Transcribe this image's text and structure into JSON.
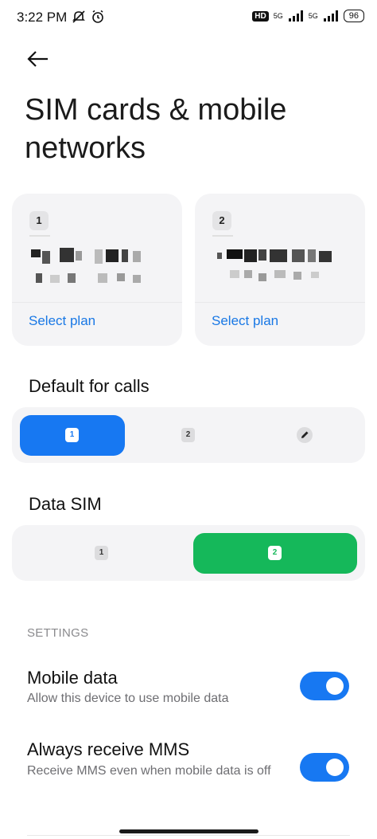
{
  "status_bar": {
    "time": "3:22 PM",
    "hd_badge": "HD",
    "network_1": "5G",
    "network_2": "5G",
    "battery": "96"
  },
  "page": {
    "title": "SIM cards & mobile networks"
  },
  "sim_cards": [
    {
      "slot": "1",
      "select_plan_label": "Select plan"
    },
    {
      "slot": "2",
      "select_plan_label": "Select plan"
    }
  ],
  "default_calls": {
    "heading": "Default for calls",
    "options": [
      "1",
      "2",
      "pencil-icon"
    ],
    "selected": "1",
    "active_color": "#1778f2"
  },
  "data_sim": {
    "heading": "Data SIM",
    "options": [
      "1",
      "2"
    ],
    "selected": "2",
    "active_color": "#15b85a"
  },
  "settings": {
    "section_label": "SETTINGS",
    "items": [
      {
        "title": "Mobile data",
        "subtitle": "Allow this device to use mobile data",
        "enabled": true
      },
      {
        "title": "Always receive MMS",
        "subtitle": "Receive MMS even when mobile data is off",
        "enabled": true
      }
    ]
  }
}
